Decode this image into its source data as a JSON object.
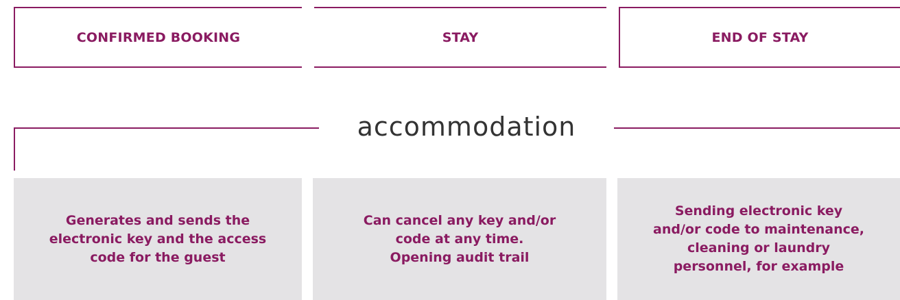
{
  "stages": [
    {
      "label": "CONFIRMED BOOKING"
    },
    {
      "label": "STAY"
    },
    {
      "label": "END OF STAY"
    }
  ],
  "section": {
    "title": "accommodation"
  },
  "cards": [
    {
      "text": "Generates and sends the\nelectronic key and the access\ncode for the guest"
    },
    {
      "text": "Can cancel any key and/or\ncode at any time.\nOpening audit trail"
    },
    {
      "text": "Sending electronic key\nand/or code to maintenance,\ncleaning or laundry\npersonnel, for example"
    }
  ],
  "colors": {
    "accent": "#8a1b61",
    "card_background": "#e4e3e5",
    "title_text": "#333333"
  }
}
